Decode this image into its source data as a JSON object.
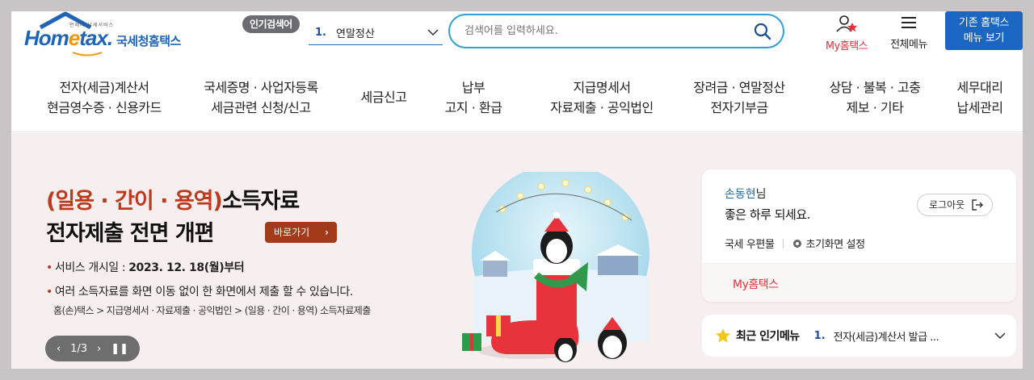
{
  "logo": {
    "tiny_text": "언제나 납세서비스",
    "brand_start": "Hom",
    "brand_e": "e",
    "brand_end": "tax.",
    "brand_kr": "국세청홈택스"
  },
  "search": {
    "popular_badge": "인기검색어",
    "popular_rank": "1.",
    "popular_term": "연말정산",
    "placeholder": "검색어를 입력하세요."
  },
  "utility": {
    "my_hometax": "My홈택스",
    "all_menu": "전체메뉴",
    "old_menu_line1": "기존 홈택스",
    "old_menu_line2": "메뉴 보기"
  },
  "nav": [
    {
      "line1": "전자(세금)계산서",
      "line2": "현금영수증 · 신용카드"
    },
    {
      "line1": "국세증명 · 사업자등록",
      "line2": "세금관련 신청/신고"
    },
    {
      "line1": "세금신고",
      "line2": ""
    },
    {
      "line1": "납부",
      "line2": "고지 · 환급"
    },
    {
      "line1": "지급명세서",
      "line2": "자료제출 · 공익법인"
    },
    {
      "line1": "장려금 · 연말정산",
      "line2": "전자기부금"
    },
    {
      "line1": "상담 · 불복 · 고충",
      "line2": "제보 · 기타"
    },
    {
      "line1": "세무대리",
      "line2": "납세관리"
    }
  ],
  "banner": {
    "title_highlight": "(일용 · 간이 · 용역)",
    "title_rest": "소득자료",
    "title_line2": "전자제출 전면 개편",
    "go_button": "바로가기",
    "info1_label": "서비스 개시일 : ",
    "info1_value": "2023. 12. 18(월)부터",
    "info2": "여러 소득자료를 화면 이동 없이 한 화면에서 제출 할 수 있습니다.",
    "path": "홈(손)택스 > 지급명세서 · 자료제출 · 공익법인 > (일용 · 간이 · 용역) 소득자료제출",
    "pager": "1/3"
  },
  "user": {
    "name": "손동현",
    "suffix": "님",
    "greeting": "좋은 하루 되세요.",
    "logout": "로그아웃",
    "mailbox": "국세 우편물",
    "init_screen": "초기화면 설정",
    "my_hometax": "My홈택스"
  },
  "popular_menu": {
    "title": "최근 인기메뉴",
    "rank": "1.",
    "item": "전자(세금)계산서 발급 ..."
  },
  "colors": {
    "brand_blue": "#1f64b7",
    "accent_red": "#e6323c",
    "banner_bg": "#f7eeef",
    "button_blue": "#1a66c2"
  }
}
